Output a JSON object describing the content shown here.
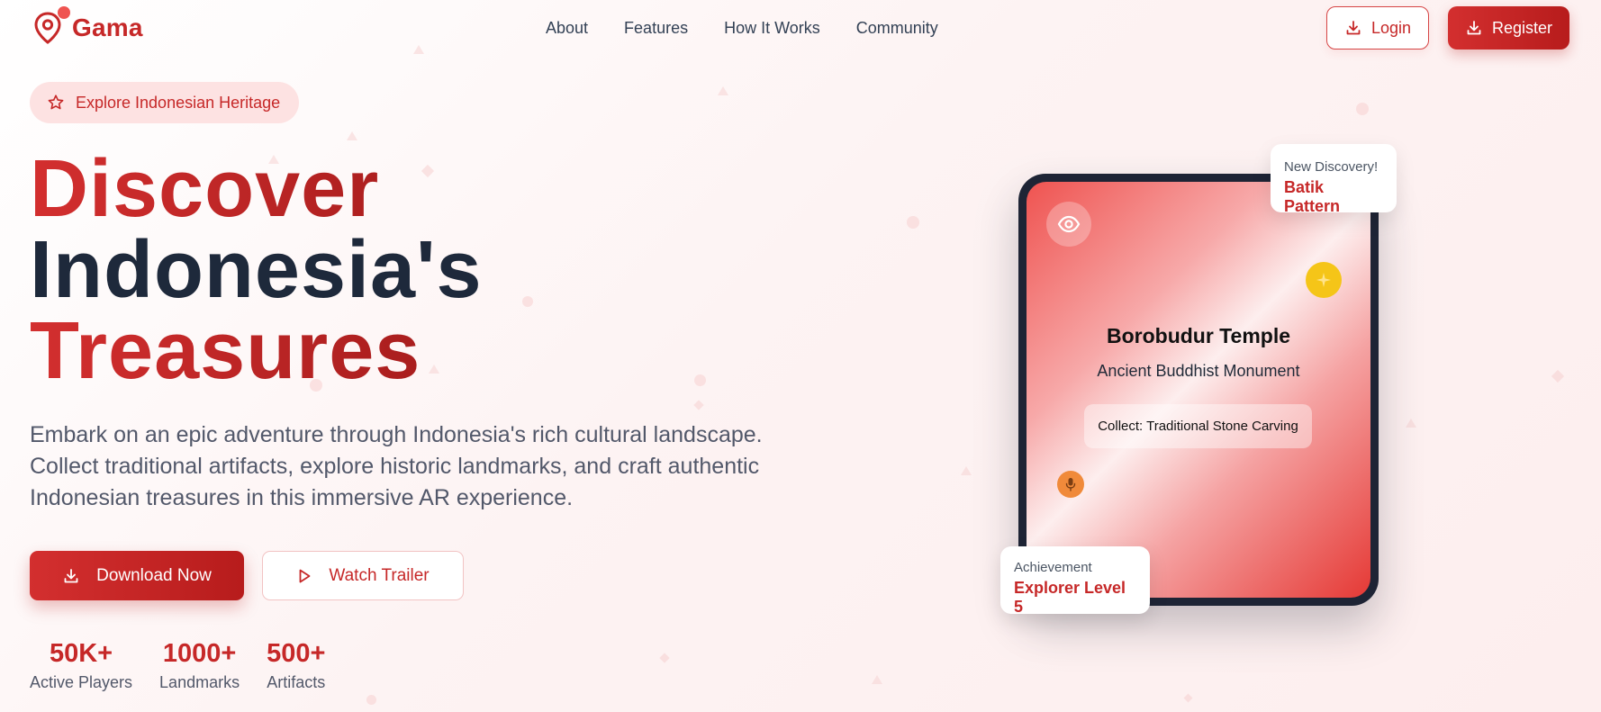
{
  "brand": {
    "name": "Gama",
    "accent": "#c62828",
    "accent_dark": "#b71c1c"
  },
  "nav": {
    "links": [
      "About",
      "Features",
      "How It Works",
      "Community"
    ],
    "login_label": "Login",
    "register_label": "Register"
  },
  "hero": {
    "badge_label": "Explore Indonesian Heritage",
    "headline": {
      "line1": "Discover",
      "line2": "Indonesia's",
      "line3": "Treasures"
    },
    "description": "Embark on an epic adventure through Indonesia's rich cultural landscape. Collect traditional artifacts, explore historic landmarks, and craft authentic Indonesian treasures in this immersive AR experience.",
    "download_label": "Download Now",
    "trailer_label": "Watch Trailer",
    "stats": [
      {
        "value": "50K+",
        "label": "Active Players"
      },
      {
        "value": "1000+",
        "label": "Landmarks"
      },
      {
        "value": "500+",
        "label": "Artifacts"
      }
    ]
  },
  "phone": {
    "site_title": "Borobudur Temple",
    "site_subtitle": "Ancient Buddhist Monument",
    "collect_text": "Collect: Traditional Stone Carving",
    "icons": [
      "eye-icon",
      "sparkle-icon",
      "microphone-icon"
    ]
  },
  "floating_cards": {
    "discovery": {
      "kicker": "New Discovery!",
      "title": "Batik Pattern"
    },
    "achievement": {
      "kicker": "Achievement",
      "title": "Explorer Level 5"
    }
  }
}
